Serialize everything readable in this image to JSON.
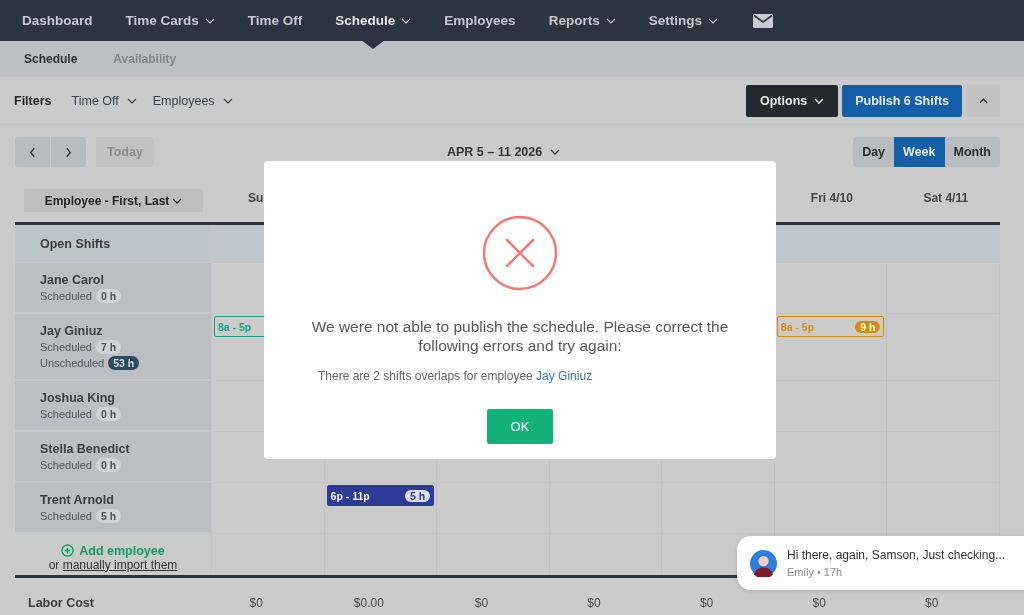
{
  "nav": {
    "items": [
      {
        "label": "Dashboard",
        "dropdown": false,
        "selected": false
      },
      {
        "label": "Time Cards",
        "dropdown": true,
        "selected": false
      },
      {
        "label": "Time Off",
        "dropdown": false,
        "selected": false
      },
      {
        "label": "Schedule",
        "dropdown": true,
        "selected": true
      },
      {
        "label": "Employees",
        "dropdown": false,
        "selected": false
      },
      {
        "label": "Reports",
        "dropdown": true,
        "selected": false
      },
      {
        "label": "Settings",
        "dropdown": true,
        "selected": false
      }
    ]
  },
  "subtabs": [
    {
      "label": "Schedule",
      "selected": true
    },
    {
      "label": "Availability",
      "selected": false
    }
  ],
  "filters": {
    "label": "Filters",
    "items": [
      {
        "label": "Time Off"
      },
      {
        "label": "Employees"
      }
    ],
    "options": "Options",
    "publish": "Publish 6 Shifts"
  },
  "toolbar": {
    "today": {
      "label": "Today",
      "disabled": true
    },
    "date_range": "APR 5 – 11 2026",
    "views": [
      {
        "label": "Day",
        "selected": false
      },
      {
        "label": "Week",
        "selected": true
      },
      {
        "label": "Month",
        "selected": false
      }
    ]
  },
  "grid": {
    "sort_label": "Employee - First, Last",
    "day_headers": [
      {
        "kind": "day",
        "label": "Su"
      },
      {
        "kind": "covered"
      },
      {
        "kind": "covered"
      },
      {
        "kind": "covered"
      },
      {
        "kind": "covered"
      },
      {
        "kind": "day",
        "label": "Fri 4/10"
      },
      {
        "kind": "day",
        "label": "Sat 4/11"
      }
    ],
    "open_shifts": "Open Shifts",
    "employees": [
      {
        "name": "Jane Carol",
        "scheduled_label": "Scheduled",
        "scheduled": "0 h"
      },
      {
        "name": "Jay Giniuz",
        "scheduled_label": "Scheduled",
        "scheduled": "7 h",
        "unscheduled_label": "Unscheduled",
        "unscheduled": "53 h",
        "shifts": [
          {
            "kind": "outline",
            "color": "#13a58a",
            "time": "8a - 5p"
          },
          {
            "kind": "none"
          },
          {
            "kind": "none"
          },
          {
            "kind": "none"
          },
          {
            "kind": "none"
          },
          {
            "kind": "outline",
            "color": "#d88a0a",
            "time": "8a - 5p",
            "hours": "9 h"
          },
          {
            "kind": "none"
          }
        ]
      },
      {
        "name": "Joshua King",
        "scheduled_label": "Scheduled",
        "scheduled": "0 h"
      },
      {
        "name": "Stella Benedict",
        "scheduled_label": "Scheduled",
        "scheduled": "0 h"
      },
      {
        "name": "Trent Arnold",
        "scheduled_label": "Scheduled",
        "scheduled": "5 h",
        "shifts": [
          {
            "kind": "none"
          },
          {
            "kind": "solid",
            "color": "#2e3a9a",
            "time": "6p - 11p",
            "hours": "5 h"
          },
          {
            "kind": "none"
          },
          {
            "kind": "none"
          },
          {
            "kind": "none"
          },
          {
            "kind": "none"
          },
          {
            "kind": "none"
          }
        ]
      }
    ],
    "add_employee": "Add employee",
    "import_prefix": "or",
    "import_link": "manually import them",
    "labor_label": "Labor Cost",
    "labor": [
      "$0",
      "$0.00",
      "$0",
      "$0",
      "$0",
      "$0",
      "$0"
    ]
  },
  "modal": {
    "message": "We were not able to publish the schedule. Please correct the following errors and try again:",
    "detail": "There are 2 shifts overlaps for employee",
    "detail_link": "Jay Giniuz",
    "button": "OK"
  },
  "chat": {
    "message": "Hi there, again, Samson, Just checking...",
    "meta": "Emily • 17h"
  }
}
